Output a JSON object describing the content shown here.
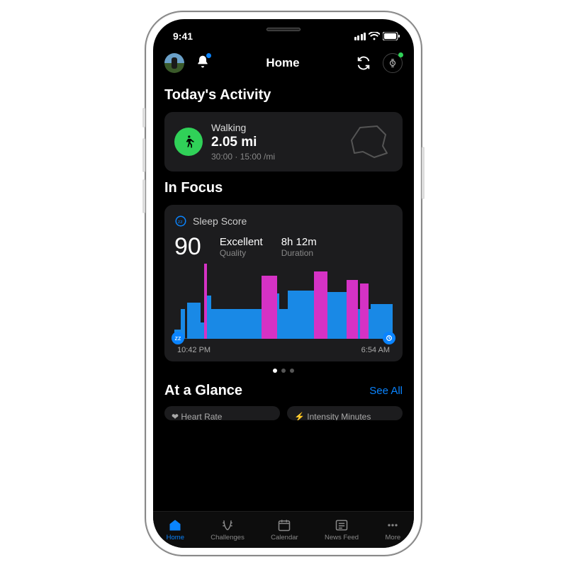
{
  "status": {
    "time": "9:41"
  },
  "nav": {
    "title": "Home"
  },
  "sections": {
    "activity_title": "Today's Activity",
    "focus_title": "In Focus",
    "glance_title": "At a Glance",
    "see_all": "See All"
  },
  "activity": {
    "type": "Walking",
    "distance": "2.05 mi",
    "details": "30:00 · 15:00 /mi"
  },
  "sleep": {
    "label": "Sleep Score",
    "score": "90",
    "quality_value": "Excellent",
    "quality_label": "Quality",
    "duration_value": "8h 12m",
    "duration_label": "Duration",
    "start_time": "10:42 PM",
    "end_time": "6:54 AM"
  },
  "glance": {
    "card1": "Heart Rate",
    "card2": "Intensity Minutes"
  },
  "tabs": {
    "home": "Home",
    "challenges": "Challenges",
    "calendar": "Calendar",
    "newsfeed": "News Feed",
    "more": "More"
  },
  "chart_data": {
    "type": "bar",
    "title": "Sleep Score",
    "xlabel": "",
    "ylabel": "",
    "x_range_labels": [
      "10:42 PM",
      "6:54 AM"
    ],
    "ylim_pct": [
      0,
      100
    ],
    "series": [
      {
        "name": "light/deep (blue)",
        "color": "#1989e6",
        "bars": [
          {
            "left_pct": 0,
            "width_pct": 3,
            "height_pct": 12
          },
          {
            "left_pct": 3,
            "width_pct": 2,
            "height_pct": 40
          },
          {
            "left_pct": 6,
            "width_pct": 6,
            "height_pct": 48
          },
          {
            "left_pct": 12,
            "width_pct": 2,
            "height_pct": 22
          },
          {
            "left_pct": 14,
            "width_pct": 3,
            "height_pct": 58
          },
          {
            "left_pct": 17,
            "width_pct": 24,
            "height_pct": 40
          },
          {
            "left_pct": 41,
            "width_pct": 7,
            "height_pct": 60
          },
          {
            "left_pct": 48,
            "width_pct": 4,
            "height_pct": 40
          },
          {
            "left_pct": 52,
            "width_pct": 12,
            "height_pct": 64
          },
          {
            "left_pct": 64,
            "width_pct": 6,
            "height_pct": 40
          },
          {
            "left_pct": 70,
            "width_pct": 14,
            "height_pct": 62
          },
          {
            "left_pct": 84,
            "width_pct": 6,
            "height_pct": 40
          },
          {
            "left_pct": 90,
            "width_pct": 10,
            "height_pct": 46
          }
        ]
      },
      {
        "name": "REM/awake (pink)",
        "color": "#d532c5",
        "bars": [
          {
            "left_pct": 13.5,
            "width_pct": 1.5,
            "height_pct": 100
          },
          {
            "left_pct": 40,
            "width_pct": 7,
            "height_pct": 84
          },
          {
            "left_pct": 64,
            "width_pct": 6,
            "height_pct": 90
          },
          {
            "left_pct": 79,
            "width_pct": 5,
            "height_pct": 78
          },
          {
            "left_pct": 85,
            "width_pct": 4,
            "height_pct": 74
          }
        ]
      }
    ]
  }
}
